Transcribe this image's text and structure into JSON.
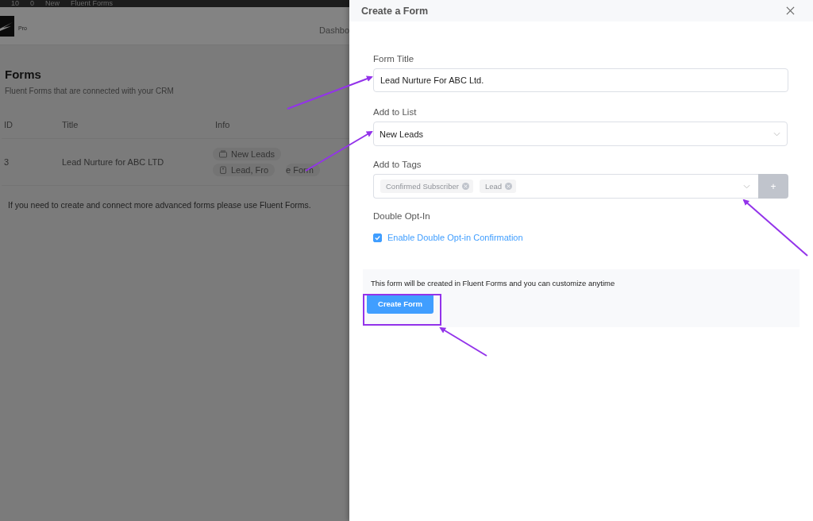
{
  "admin_bar": {
    "items": [
      "10",
      "0",
      "New",
      "Fluent Forms"
    ]
  },
  "app_header": {
    "badge": "Pro",
    "nav": [
      "Dashbo"
    ]
  },
  "page": {
    "title": "Forms",
    "subtitle": "Fluent Forms that are connected with your CRM"
  },
  "table": {
    "columns": [
      "ID",
      "Title",
      "Info"
    ],
    "rows": [
      {
        "id": "3",
        "title": "Lead Nurture for ABC LTD",
        "info": [
          {
            "kind": "list",
            "text": "New Leads"
          },
          {
            "kind": "tag",
            "text": "Lead, Fro"
          },
          {
            "kind": "plain",
            "text": "e Form"
          }
        ]
      }
    ]
  },
  "note": "If you need to create and connect more advanced forms please use Fluent Forms.",
  "drawer": {
    "title": "Create a Form",
    "form_title": {
      "label": "Form Title",
      "value": "Lead Nurture For ABC Ltd."
    },
    "list": {
      "label": "Add to List",
      "value": "New Leads"
    },
    "tags": {
      "label": "Add to Tags",
      "values": [
        "Confirmed Subscriber",
        "Lead"
      ],
      "add_button": "+"
    },
    "double_opt_in": {
      "label": "Double Opt-In",
      "checkbox": {
        "text": "Enable Double Opt-in Confirmation",
        "checked": true
      }
    },
    "footer": {
      "text": "This form will be created in Fluent Forms and you can customize anytime",
      "button": "Create Form"
    }
  }
}
